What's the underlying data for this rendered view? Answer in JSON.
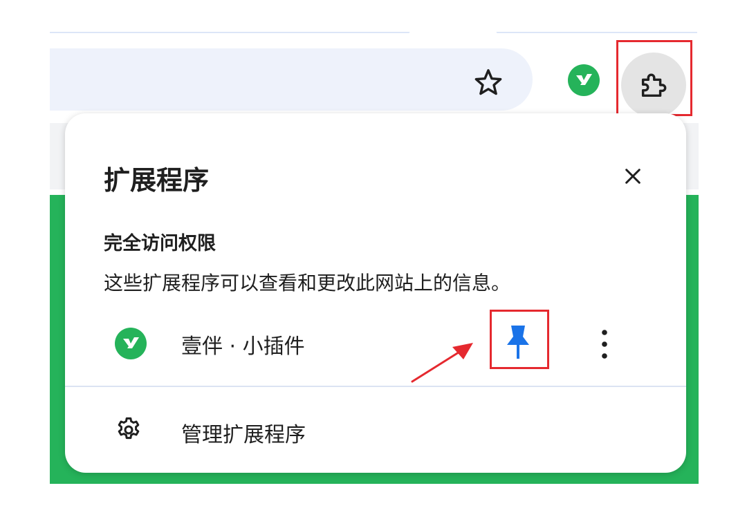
{
  "toolbar": {
    "star_icon": "star-outline-icon",
    "extension_icon": "yiban-logo-icon",
    "puzzle_icon": "puzzle-piece-icon"
  },
  "popup": {
    "title": "扩展程序",
    "close_icon": "close-icon",
    "section_heading": "完全访问权限",
    "section_description": "这些扩展程序可以查看和更改此网站上的信息。",
    "extension": {
      "name": "壹伴 · 小插件",
      "pin_icon": "pin-icon",
      "more_icon": "more-vert-icon"
    },
    "manage": {
      "label": "管理扩展程序",
      "icon": "gear-icon"
    }
  },
  "colors": {
    "highlight": "#e5292f",
    "pin": "#1a73e8",
    "brand_green": "#25b35a",
    "omnibox": "#eef2fb"
  }
}
